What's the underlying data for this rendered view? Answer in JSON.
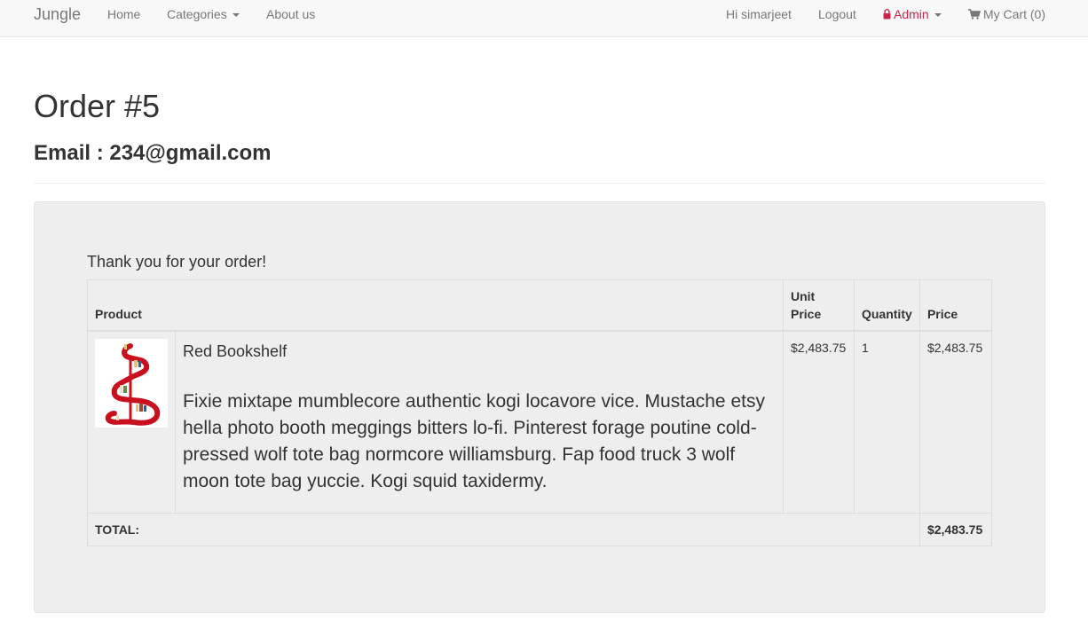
{
  "nav": {
    "brand": "Jungle",
    "home": "Home",
    "categories": "Categories",
    "about": "About us",
    "greeting": "Hi simarjeet",
    "logout": "Logout",
    "admin": "Admin",
    "cart": "My Cart (0)",
    "admin_color": "#c7254e"
  },
  "header": {
    "title": "Order #5",
    "email": "Email : 234@gmail.com"
  },
  "order": {
    "thanks": "Thank you for your order!",
    "columns": {
      "product": "Product",
      "unit_price": "Unit Price",
      "quantity": "Quantity",
      "price": "Price"
    },
    "items": [
      {
        "name": "Red Bookshelf",
        "description": "Fixie mixtape mumblecore authentic kogi locavore vice. Mustache etsy hella photo booth meggings bitters lo-fi. Pinterest forage poutine cold-pressed wolf tote bag normcore williamsburg. Fap food truck 3 wolf moon tote bag yuccie. Kogi squid taxidermy.",
        "unit_price": "$2,483.75",
        "quantity": "1",
        "price": "$2,483.75",
        "image_icon": "red-bookshelf-image"
      }
    ],
    "total_label": "TOTAL:",
    "total_value": "$2,483.75"
  }
}
